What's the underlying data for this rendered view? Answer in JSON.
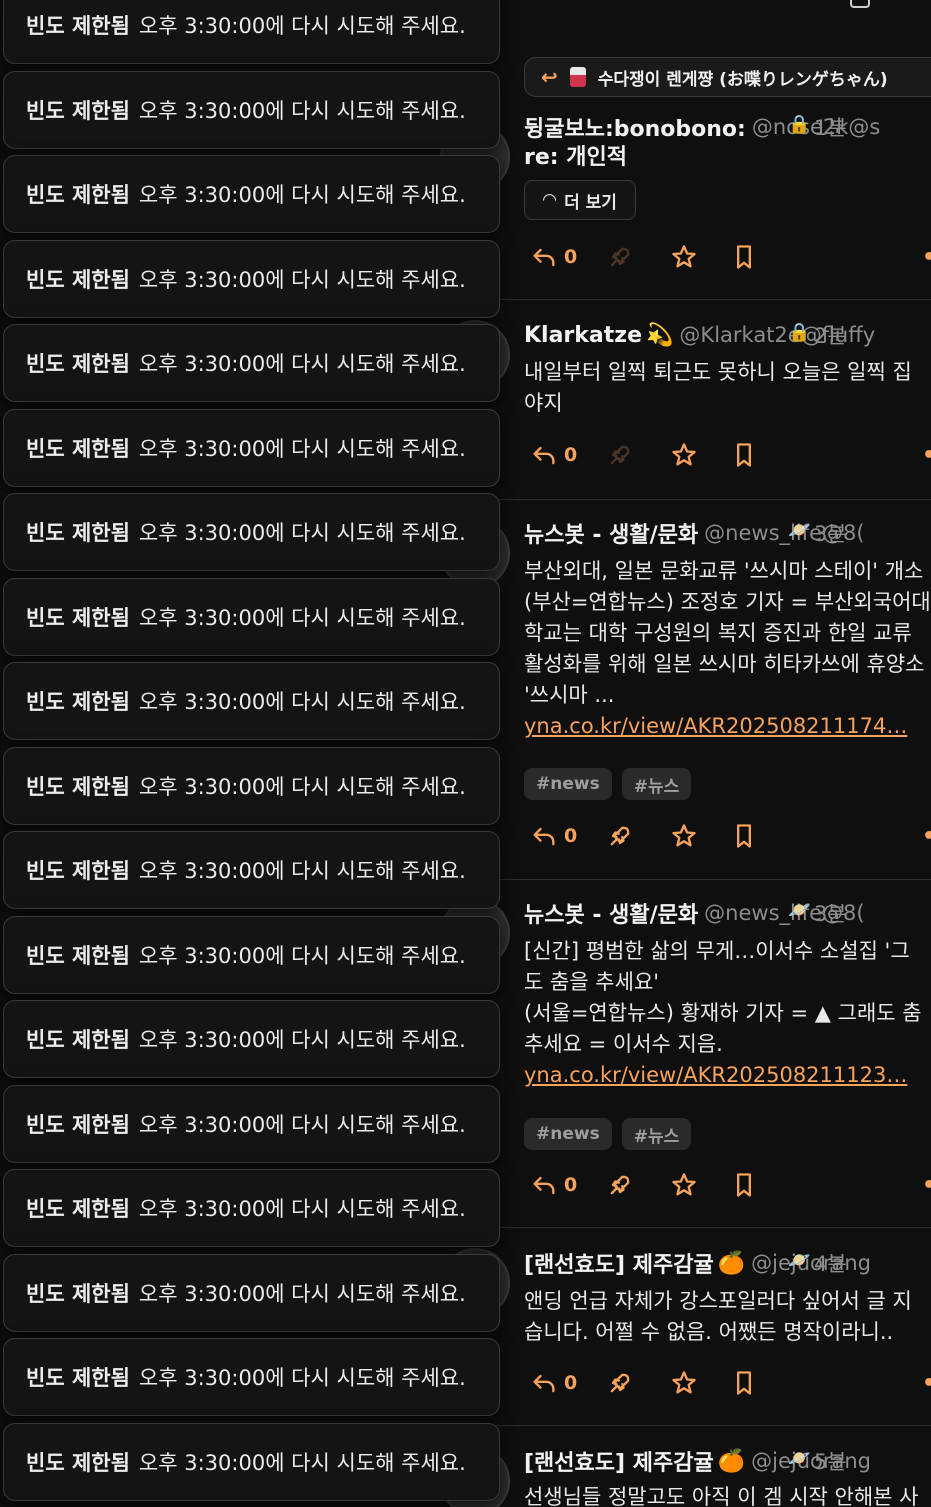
{
  "toasts": {
    "title": "빈도 제한됨",
    "message": "오후 3:30:00에 다시 시도해 주세요.",
    "count": 18
  },
  "timeline": {
    "reply_banner": {
      "text": "수다쟁이 렌게쨩 (お喋りレンゲちゃん)"
    },
    "notes": [
      {
        "name": "뒹굴보노:bonobono:",
        "username": "@nose2k@s",
        "visibility": "lock-icon",
        "time": "1분",
        "subject": "re: 개인적",
        "more_label": "더 보기",
        "lines": [],
        "link": "",
        "tags": [],
        "reply_count": "0",
        "renote_enabled": false
      },
      {
        "name": "Klarkatze",
        "username": "@Klarkat2e@fluffy",
        "visibility": "lock-icon",
        "time": "2분",
        "subject": "",
        "more_label": "",
        "lines": [
          "내일부터 일찍 퇴근도 못하니 오늘은 일찍 집",
          "야지"
        ],
        "link": "",
        "tags": [],
        "reply_count": "0",
        "renote_enabled": false
      },
      {
        "name": "뉴스봇 - 생활/문화",
        "username": "@news_life@8(",
        "visibility": "planet-icon",
        "time": "3분",
        "subject": "",
        "more_label": "",
        "lines": [
          "부산외대, 일본 문화교류 '쓰시마 스테이' 개소",
          "(부산=연합뉴스) 조정호 기자 = 부산외국어대",
          "학교는 대학 구성원의 복지 증진과 한일 교류",
          "활성화를 위해 일본 쓰시마 히타카쓰에 휴양소",
          "'쓰시마 ..."
        ],
        "link": "yna.co.kr/view/AKR202508211174…",
        "tags": [
          "#news",
          "#뉴스"
        ],
        "reply_count": "0",
        "renote_enabled": true
      },
      {
        "name": "뉴스봇 - 생활/문화",
        "username": "@news_life@8(",
        "visibility": "planet-icon",
        "time": "3분",
        "subject": "",
        "more_label": "",
        "lines": [
          "[신간] 평범한 삶의 무게…이서수 소설집 '그",
          "도 춤을 추세요'",
          "(서울=연합뉴스) 황재하 기자 = ▲ 그래도 춤",
          "추세요 = 이서수 지음."
        ],
        "link": "yna.co.kr/view/AKR202508211123…",
        "tags": [
          "#news",
          "#뉴스"
        ],
        "reply_count": "0",
        "renote_enabled": true
      },
      {
        "name": "[랜선효도] 제주감귤",
        "username": "@jejuorang",
        "visibility": "planet-icon",
        "time": "4분",
        "subject": "",
        "more_label": "",
        "lines": [
          "앤딩 언급 자체가 강스포일러다 싶어서 글 지",
          "습니다. 어쩔 수 없음. 어쨌든 명작이라니.."
        ],
        "link": "",
        "tags": [],
        "reply_count": "0",
        "renote_enabled": true
      },
      {
        "name": "[랜선효도] 제주감귤",
        "username": "@jejuorang",
        "visibility": "planet-icon",
        "time": "5분",
        "subject": "",
        "more_label": "",
        "lines": [
          "선생님들 정말고도 아직 이 겜 시작 안해본 사"
        ],
        "link": "",
        "tags": [],
        "reply_count": "",
        "renote_enabled": true
      }
    ]
  },
  "colors": {
    "accent": "#f7a35c",
    "background": "#0f0f0f",
    "toast_bg": "#141414"
  }
}
